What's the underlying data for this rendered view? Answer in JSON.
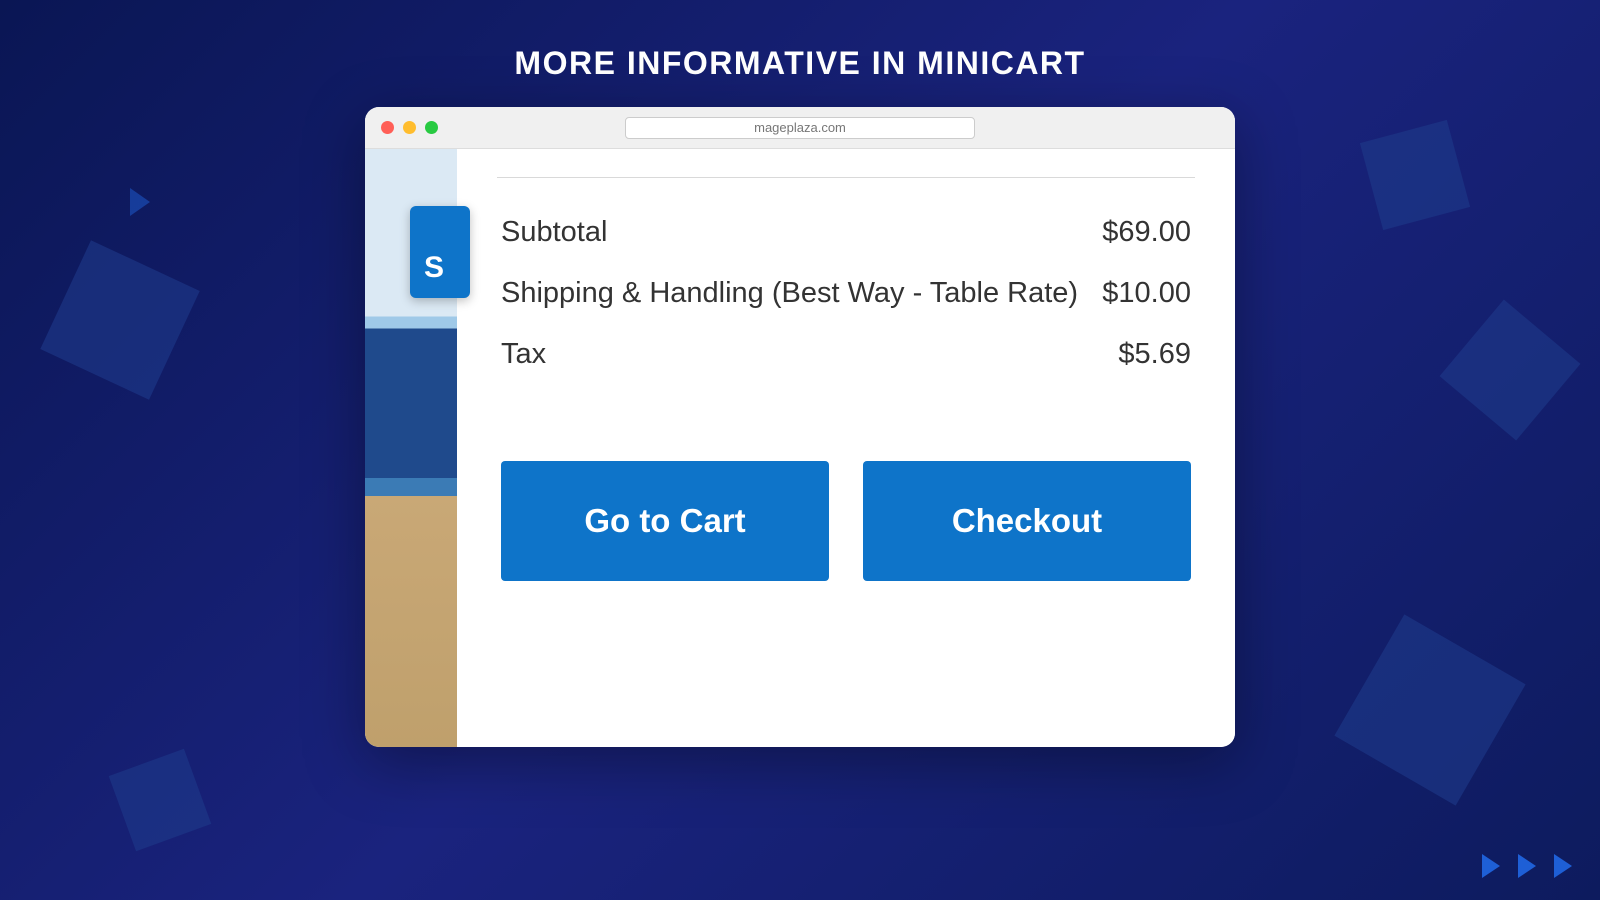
{
  "heading": "MORE INFORMATIVE IN MINICART",
  "browser": {
    "url": "mageplaza.com"
  },
  "sliver_button_text": "S",
  "minicart": {
    "lines": [
      {
        "label": "Subtotal",
        "value": "$69.00"
      },
      {
        "label": "Shipping & Handling (Best Way - Table Rate)",
        "value": "$10.00"
      },
      {
        "label": "Tax",
        "value": "$5.69"
      }
    ],
    "go_to_cart_label": "Go to Cart",
    "checkout_label": "Checkout"
  }
}
